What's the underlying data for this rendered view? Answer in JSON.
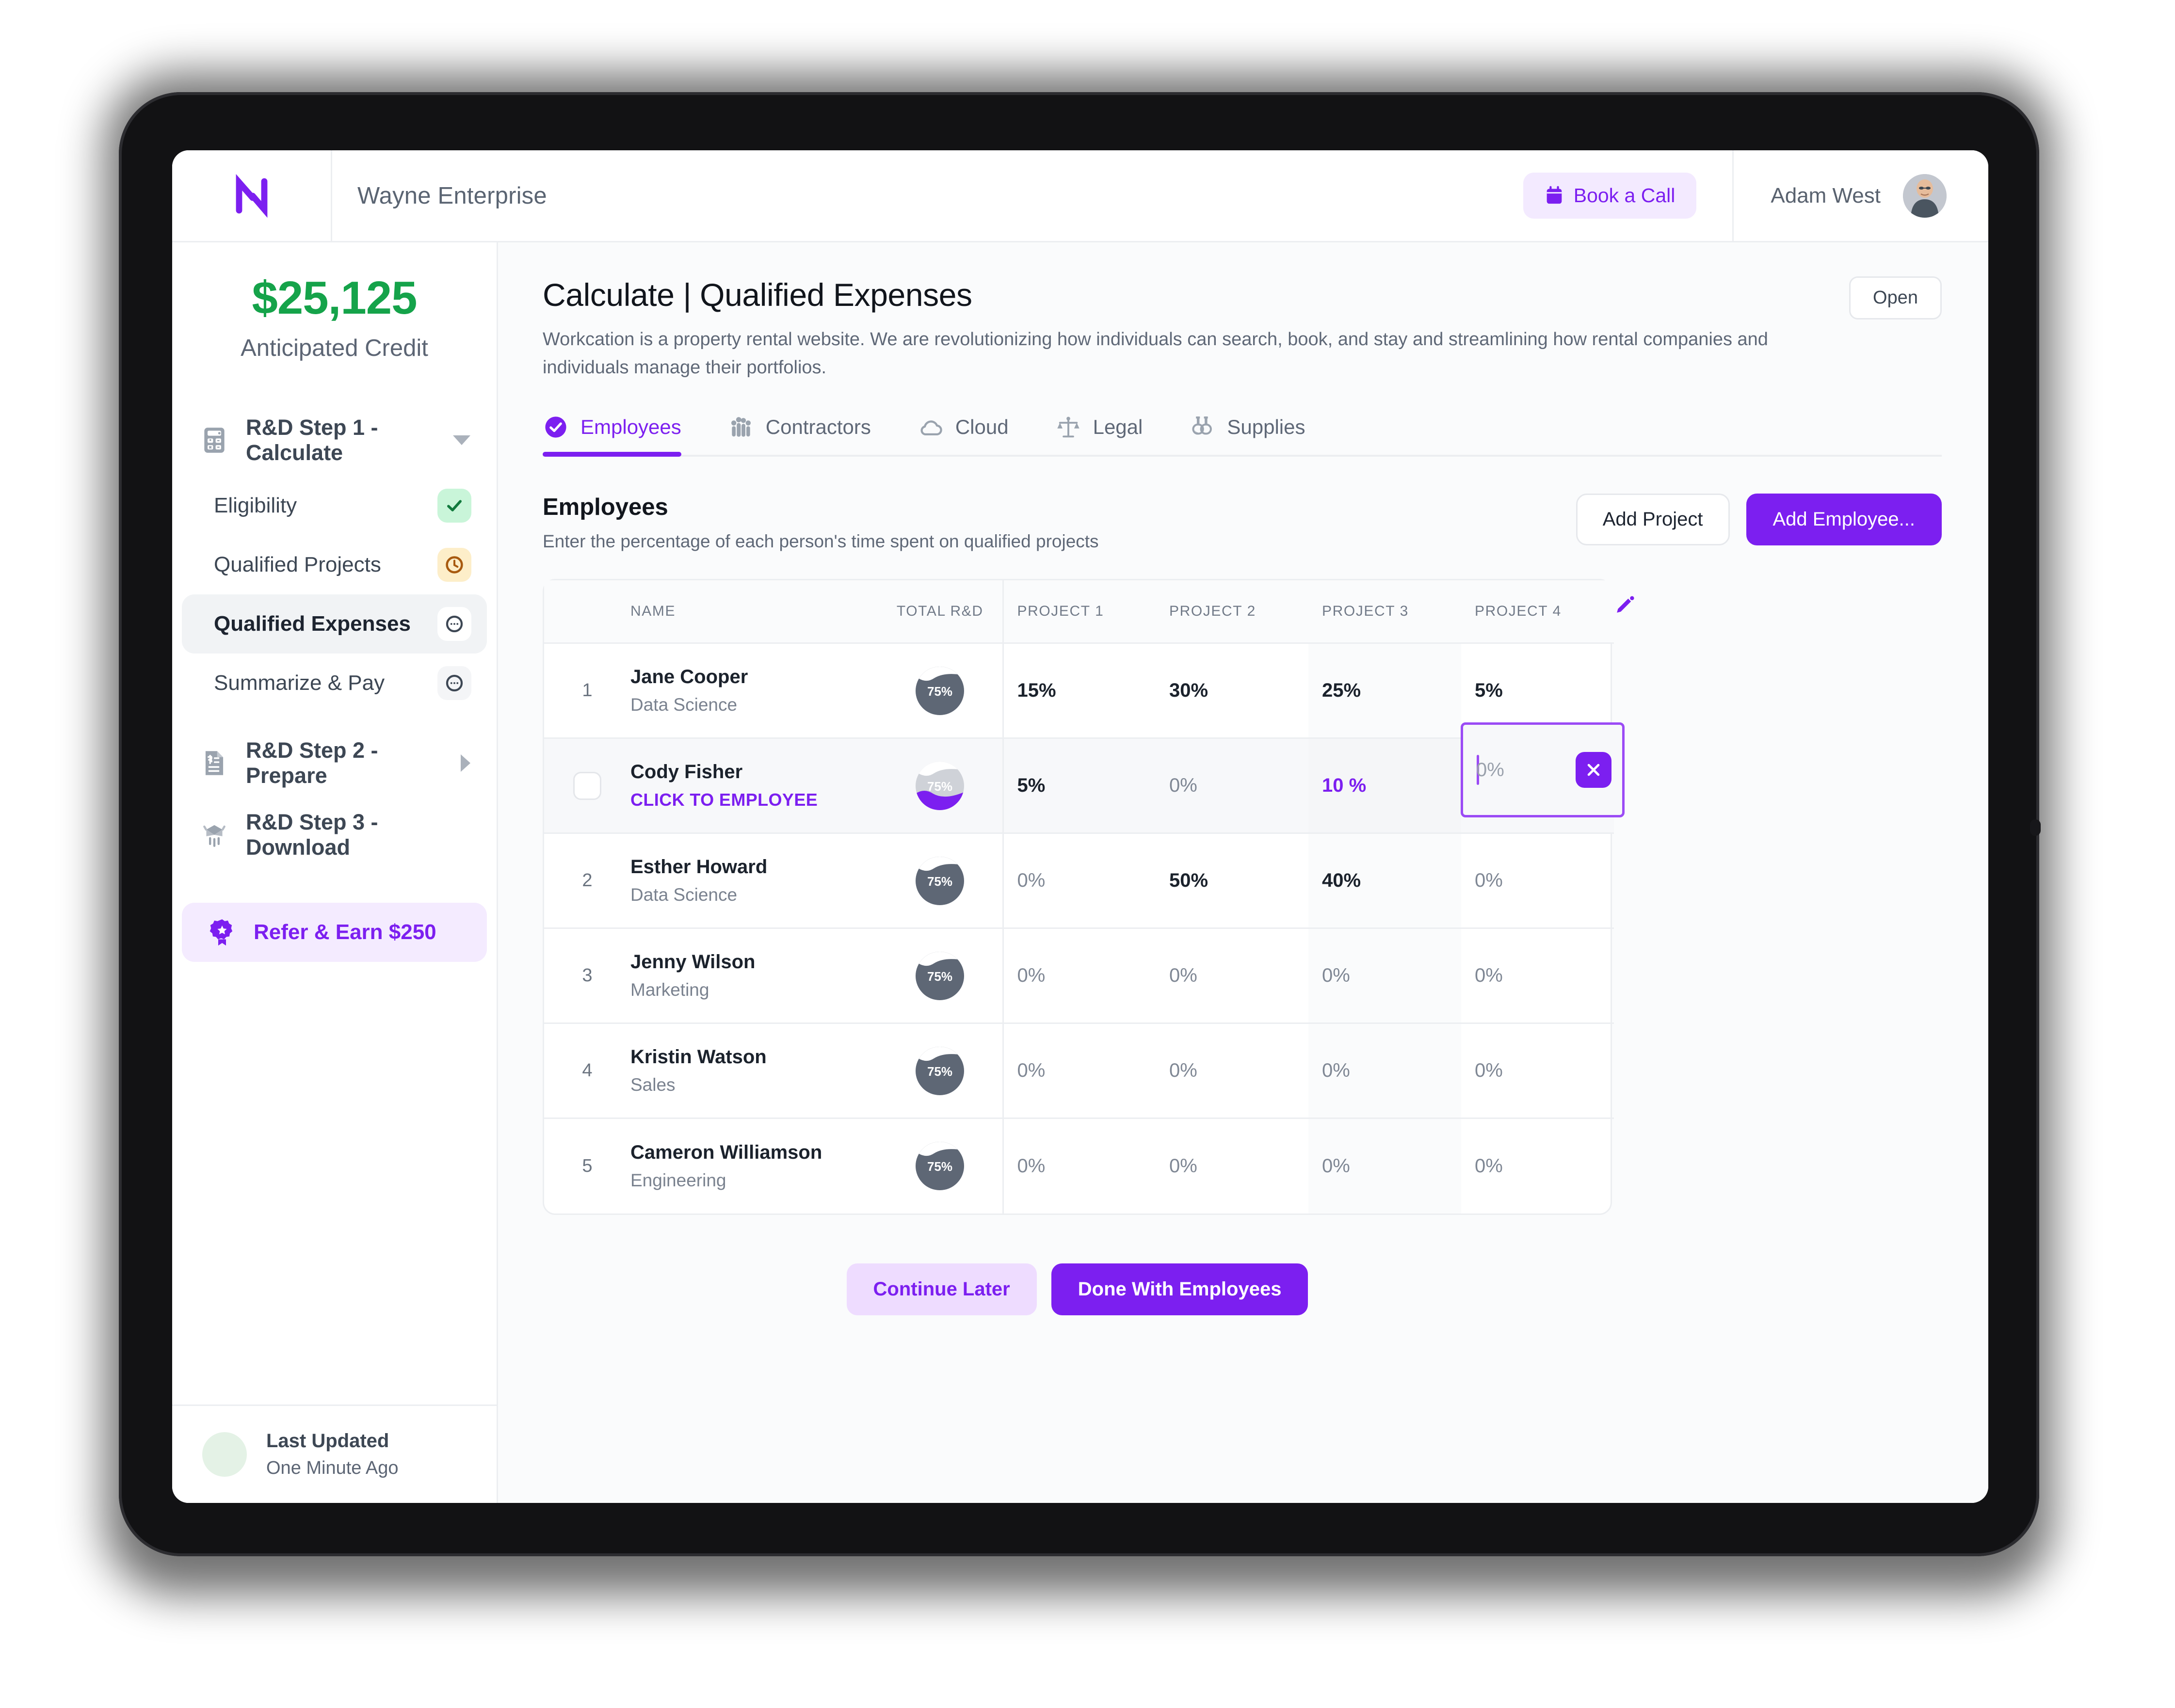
{
  "header": {
    "logo_icon": "nav-n-logo-icon",
    "brand": "Wayne Enterprise",
    "book_call_label": "Book a Call",
    "book_call_icon": "calendar-icon",
    "user_name": "Adam West",
    "avatar_icon": "user-avatar"
  },
  "sidebar": {
    "credit_amount": "$25,125",
    "credit_label": "Anticipated Credit",
    "groups": [
      {
        "label": "R&D Step 1 - Calculate",
        "icon": "calculator-icon",
        "caret": "chevron-down-icon",
        "expanded": true
      },
      {
        "label": "R&D Step 2 - Prepare",
        "icon": "invoice-icon",
        "caret": "chevron-right-icon",
        "expanded": false
      },
      {
        "label": "R&D Step 3 - Download",
        "icon": "download-package-icon",
        "caret": "",
        "expanded": false
      }
    ],
    "sub_items": [
      {
        "label": "Eligibility",
        "status": "complete",
        "status_icon": "check-icon"
      },
      {
        "label": "Qualified Projects",
        "status": "pending",
        "status_icon": "clock-icon"
      },
      {
        "label": "Qualified Expenses",
        "status": "todo",
        "status_icon": "minus-circle-icon",
        "active": true
      },
      {
        "label": "Summarize & Pay",
        "status": "todo",
        "status_icon": "minus-circle-icon"
      }
    ],
    "refer": {
      "label": "Refer & Earn $250",
      "icon": "award-ribbon-icon"
    },
    "footer": {
      "title": "Last Updated",
      "subtitle": "One Minute Ago",
      "dot_color": "#e4f2e6"
    }
  },
  "main": {
    "page_title": "Calculate | Qualified Expenses",
    "page_description": "Workcation is a property rental website. We are revolutionizing how individuals can search, book, and stay and streamlining how rental companies and individuals manage their portfolios.",
    "open_label": "Open",
    "tabs": [
      {
        "label": "Employees",
        "icon": "check-circle-icon",
        "active": true
      },
      {
        "label": "Contractors",
        "icon": "people-group-icon",
        "active": false
      },
      {
        "label": "Cloud",
        "icon": "cloud-icon",
        "active": false
      },
      {
        "label": "Legal",
        "icon": "scales-icon",
        "active": false
      },
      {
        "label": "Supplies",
        "icon": "flask-icon",
        "active": false
      }
    ],
    "section": {
      "title": "Employees",
      "subtitle": "Enter the percentage of each person's time spent on qualified projects",
      "add_project_label": "Add Project",
      "add_employee_label": "Add Employee..."
    },
    "table": {
      "edit_icon": "pencil-icon",
      "columns": [
        "",
        "NAME",
        "TOTAL R&D",
        "PROJECT 1",
        "PROJECT 2",
        "PROJECT 3",
        "PROJECT 4"
      ],
      "shaded_column": "PROJECT 3",
      "rows": [
        {
          "index": "1",
          "name": "Jane Cooper",
          "role": "Data Science",
          "total_rd": "75%",
          "badge_style": "dark",
          "values": [
            "15%",
            "30%",
            "25%",
            "5%"
          ]
        },
        {
          "index": "",
          "name": "Cody Fisher",
          "role": "",
          "cta": "CLICK TO EMPLOYEE",
          "total_rd": "75%",
          "badge_style": "purple",
          "selected": true,
          "checkbox": true,
          "checked": false,
          "values": [
            "5%",
            "0%",
            "10 %",
            ""
          ],
          "accent_value_index": 2,
          "editing_cell": {
            "column": "PROJECT 4",
            "placeholder": "0%",
            "value": "",
            "clear_icon": "close-icon"
          }
        },
        {
          "index": "2",
          "name": "Esther Howard",
          "role": "Data Science",
          "total_rd": "75%",
          "badge_style": "dark",
          "values": [
            "0%",
            "50%",
            "40%",
            "0%"
          ]
        },
        {
          "index": "3",
          "name": "Jenny Wilson",
          "role": "Marketing",
          "total_rd": "75%",
          "badge_style": "dark",
          "values": [
            "0%",
            "0%",
            "0%",
            "0%"
          ]
        },
        {
          "index": "4",
          "name": "Kristin Watson",
          "role": "Sales",
          "total_rd": "75%",
          "badge_style": "dark",
          "values": [
            "0%",
            "0%",
            "0%",
            "0%"
          ]
        },
        {
          "index": "5",
          "name": "Cameron Williamson",
          "role": "Engineering",
          "total_rd": "75%",
          "badge_style": "dark",
          "values": [
            "0%",
            "0%",
            "0%",
            "0%"
          ]
        }
      ]
    },
    "footer_actions": {
      "continue_later_label": "Continue Later",
      "done_label": "Done With Employees"
    }
  },
  "colors": {
    "accent": "#7c1ff0",
    "accent_soft": "#eedcff",
    "green": "#15a34a",
    "amber": "#c97a10",
    "text_dark": "#1b222c",
    "text_muted": "#5f6877",
    "border": "#eceef1",
    "shade": "#fafbfc"
  }
}
